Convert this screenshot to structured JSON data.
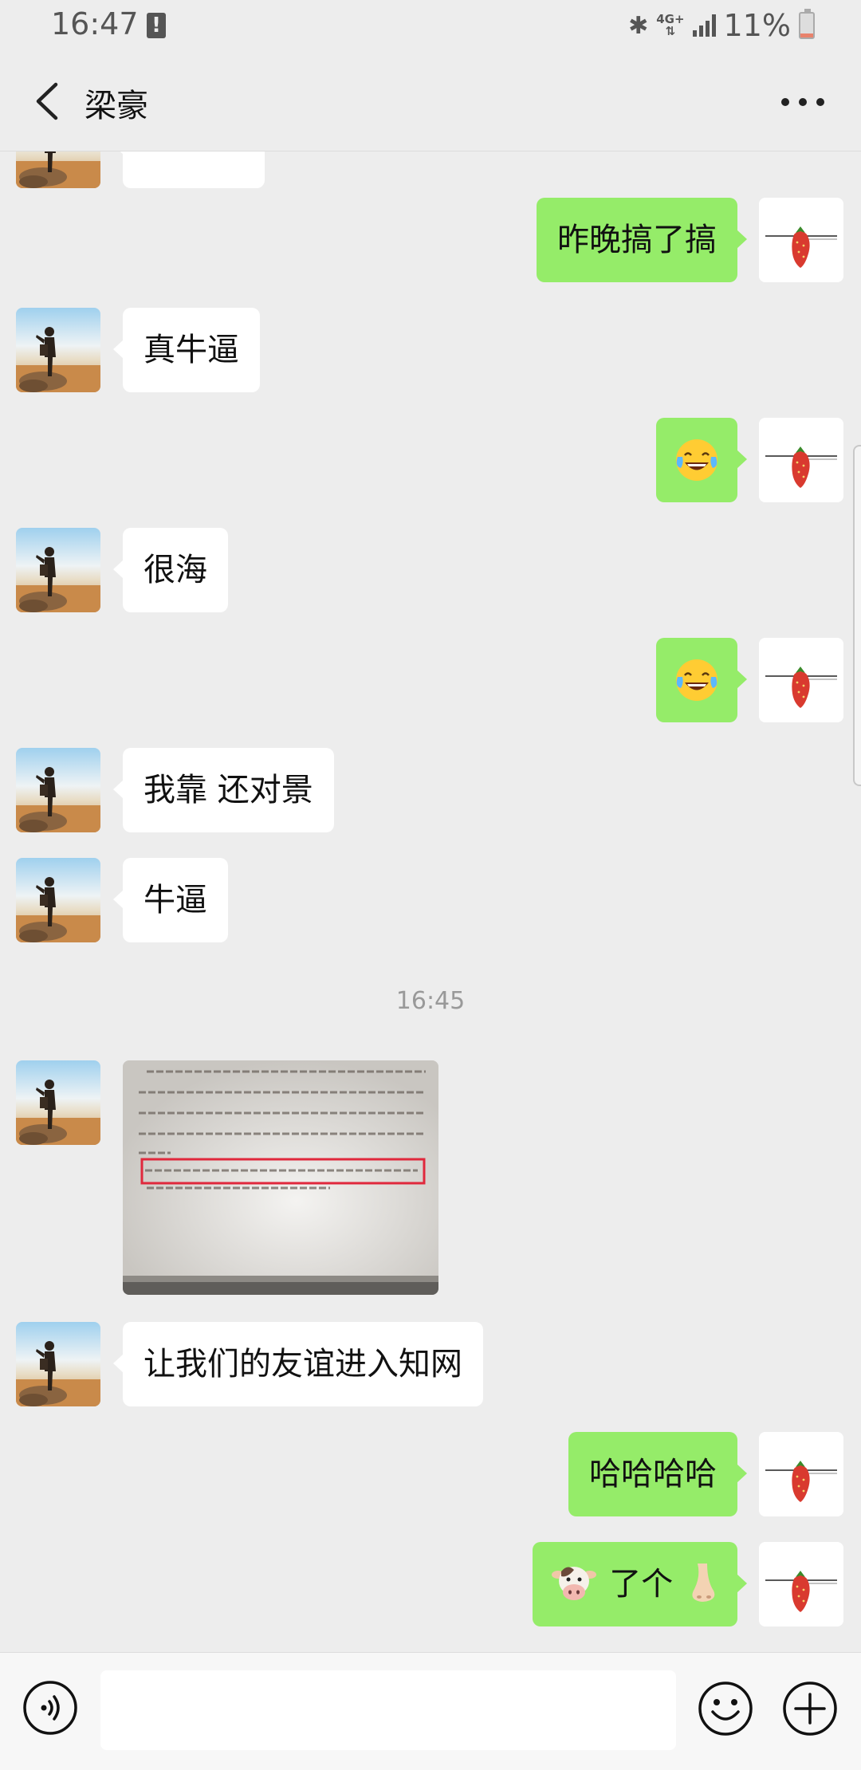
{
  "status_bar": {
    "time": "16:47",
    "network": "4G+",
    "battery": "11%",
    "battery_level": 0.11
  },
  "header": {
    "title": "梁豪",
    "back_icon": "back-chevron-icon",
    "more_icon": "more-dots-icon"
  },
  "messages": [
    {
      "side": "right",
      "type": "text",
      "text": "昨晚搞了搞"
    },
    {
      "side": "left",
      "type": "text",
      "text": "真牛逼"
    },
    {
      "side": "right",
      "type": "emoji",
      "emoji": "tears-of-joy-emoji"
    },
    {
      "side": "left",
      "type": "text",
      "text": "很海"
    },
    {
      "side": "right",
      "type": "emoji",
      "emoji": "tears-of-joy-emoji"
    },
    {
      "side": "left",
      "type": "text",
      "text": "我靠 还对景"
    },
    {
      "side": "left",
      "type": "text",
      "text": "牛逼"
    },
    {
      "type": "timestamp",
      "text": "16:45"
    },
    {
      "side": "left",
      "type": "image",
      "image": "document-photo"
    },
    {
      "side": "left",
      "type": "text",
      "text": "让我们的友谊进入知网"
    },
    {
      "side": "right",
      "type": "text",
      "text": "哈哈哈哈"
    },
    {
      "side": "right",
      "type": "text",
      "text": "了个",
      "prefix_emoji": "cow-face-emoji",
      "suffix_emoji": "nose-emoji"
    }
  ],
  "input_bar": {
    "voice_icon": "voice-icon",
    "emoji_icon": "smiley-icon",
    "plus_icon": "plus-icon",
    "message_value": ""
  },
  "colors": {
    "background": "#ededed",
    "sent_bubble": "#95ec69",
    "received_bubble": "#ffffff"
  }
}
